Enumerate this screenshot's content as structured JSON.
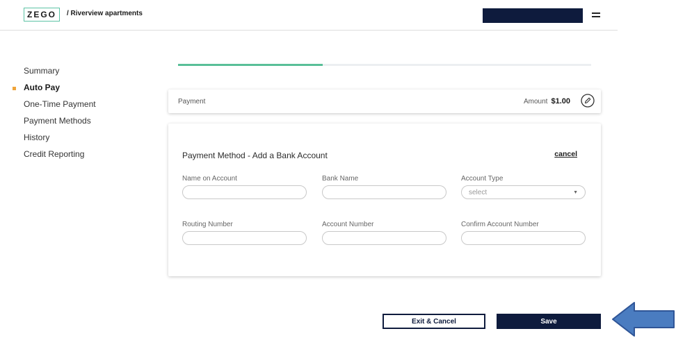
{
  "header": {
    "logo_text": "ZEGO",
    "breadcrumb": "/ Riverview apartments"
  },
  "sidebar": {
    "items": [
      {
        "label": "Summary",
        "active": false
      },
      {
        "label": "Auto Pay",
        "active": true
      },
      {
        "label": "One-Time Payment",
        "active": false
      },
      {
        "label": "Payment Methods",
        "active": false
      },
      {
        "label": "History",
        "active": false
      },
      {
        "label": "Credit Reporting",
        "active": false
      }
    ]
  },
  "progress": {
    "fraction": 0.35
  },
  "payment": {
    "label": "Payment",
    "amount_label": "Amount",
    "amount_value": "$1.00"
  },
  "form": {
    "title": "Payment Method - Add a Bank Account",
    "cancel_label": "cancel",
    "fields": {
      "name_on_account": {
        "label": "Name on Account",
        "value": ""
      },
      "bank_name": {
        "label": "Bank Name",
        "value": ""
      },
      "account_type": {
        "label": "Account Type",
        "selected": "select"
      },
      "routing_number": {
        "label": "Routing Number",
        "value": ""
      },
      "account_number": {
        "label": "Account Number",
        "value": ""
      },
      "confirm_account_number": {
        "label": "Confirm Account Number",
        "value": ""
      }
    }
  },
  "actions": {
    "exit_label": "Exit & Cancel",
    "save_label": "Save"
  },
  "colors": {
    "brand_navy": "#0e1b3d",
    "progress_green": "#59bf98",
    "active_marker": "#f0a53a",
    "annotation_arrow": "#4a7cc0"
  },
  "icons": {
    "menu": "hamburger-menu-icon",
    "edit": "pencil-icon",
    "dropdown": "chevron-down-icon",
    "annotation": "arrow-left-icon"
  }
}
